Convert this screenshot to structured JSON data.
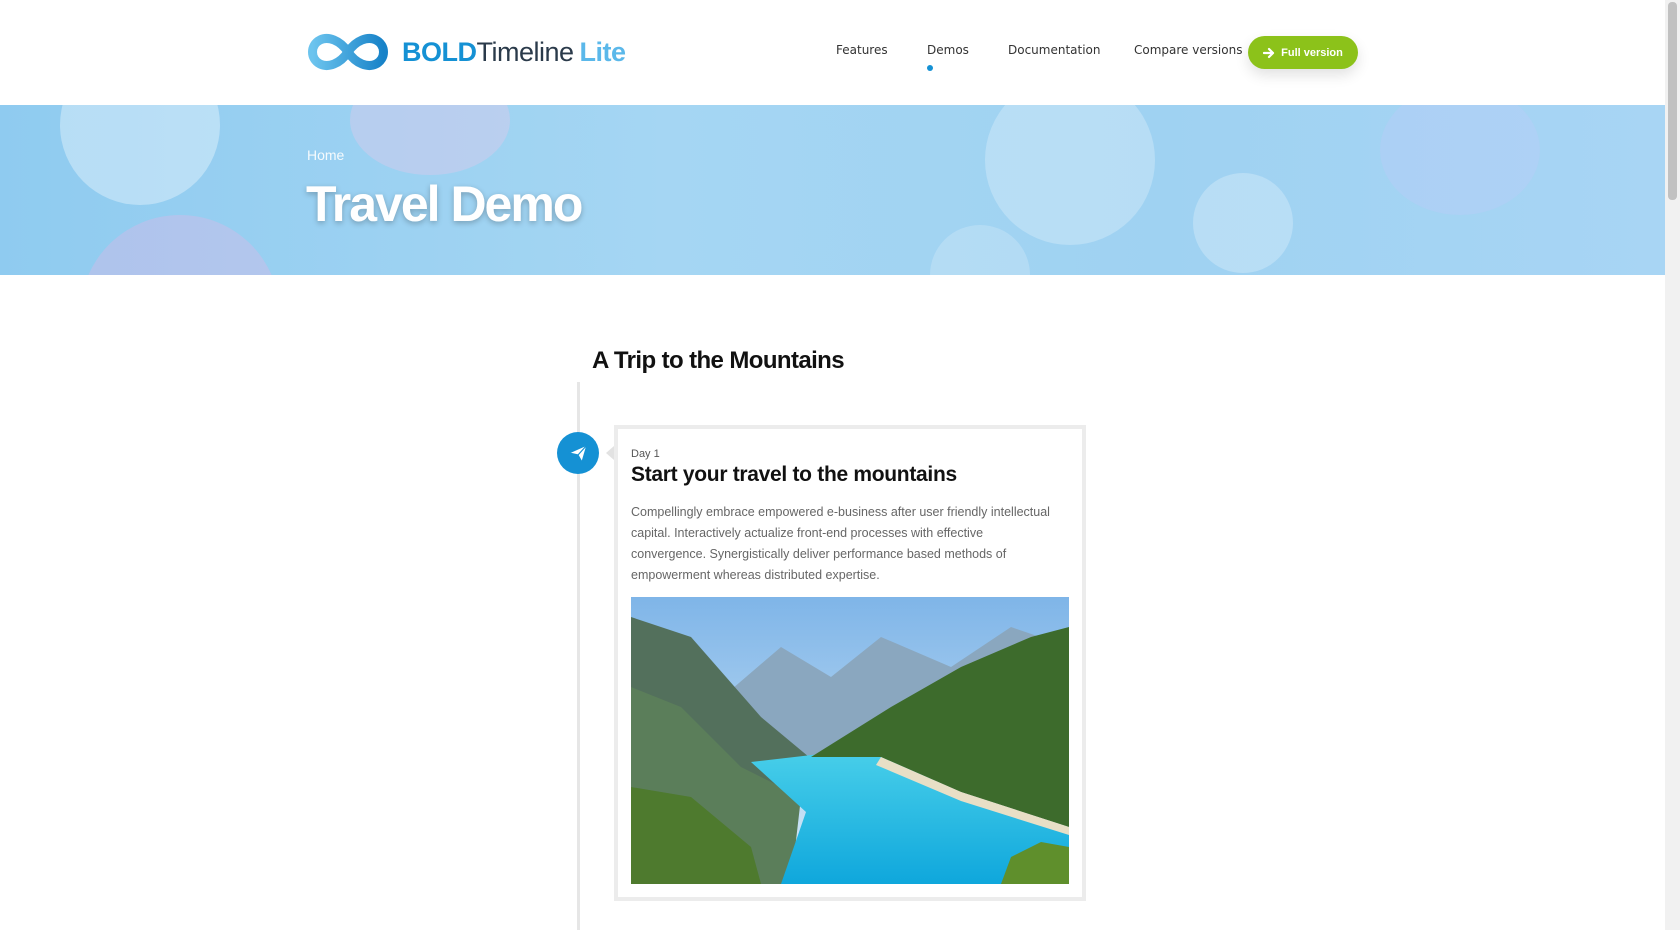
{
  "logo": {
    "bold": "BOLD",
    "middle": "Timeline",
    "lite": "Lite"
  },
  "nav": {
    "items": [
      {
        "label": "Features"
      },
      {
        "label": "Demos",
        "active": true
      },
      {
        "label": "Documentation"
      },
      {
        "label": "Compare versions"
      }
    ],
    "cta_label": "Full version",
    "cta_icon": "arrow-right-icon"
  },
  "hero": {
    "breadcrumb": "Home",
    "title": "Travel Demo"
  },
  "timeline": {
    "title": "A Trip to the Mountains",
    "items": [
      {
        "marker_icon": "paper-plane-icon",
        "day": "Day 1",
        "title": "Start your travel to the mountains",
        "text": "Compellingly embrace empowered e-business after user friendly intellectual capital. Interactively actualize front-end processes with effective convergence. Synergistically deliver performance based methods of empowerment whereas distributed expertise."
      }
    ]
  },
  "colors": {
    "accent": "#1591d4",
    "cta": "#8cc21a",
    "hero": "#a5d6f3"
  }
}
